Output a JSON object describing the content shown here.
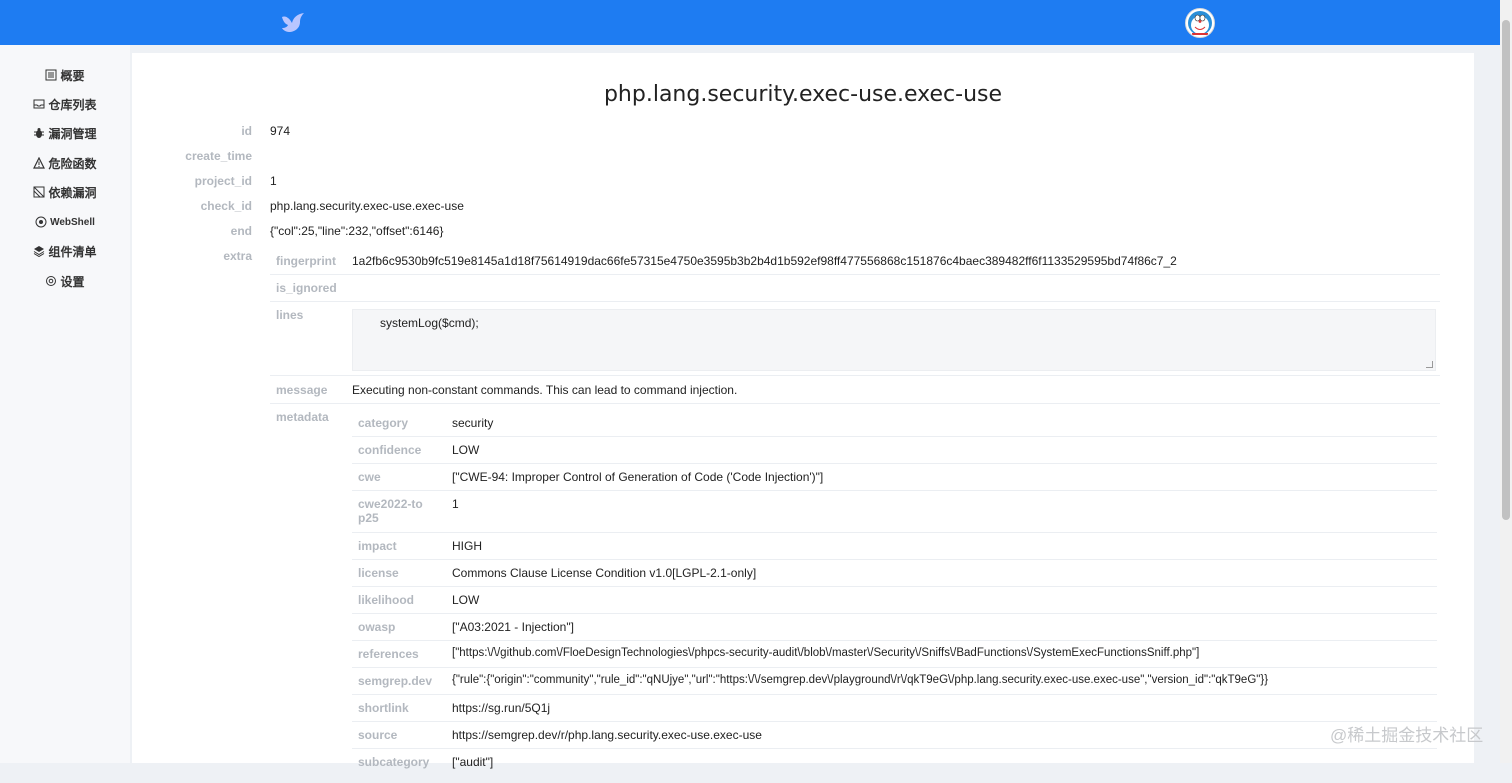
{
  "brand": {
    "logo_icon": "bird-logo-icon",
    "avatar_icon": "doraemon-avatar-icon",
    "accent": "#1e7cf2"
  },
  "sidebar": {
    "items": [
      {
        "label": "概要",
        "icon": "list-icon"
      },
      {
        "label": "仓库列表",
        "icon": "inbox-icon"
      },
      {
        "label": "漏洞管理",
        "icon": "bug-icon"
      },
      {
        "label": "危险函数",
        "icon": "warning-icon"
      },
      {
        "label": "依赖漏洞",
        "icon": "dependency-icon"
      },
      {
        "label": "WebShell",
        "icon": "eye-icon"
      },
      {
        "label": "组件清单",
        "icon": "layers-icon"
      },
      {
        "label": "设置",
        "icon": "gear-icon"
      }
    ]
  },
  "detail": {
    "title": "php.lang.security.exec-use.exec-use",
    "fields": [
      {
        "label": "id",
        "value": "974"
      },
      {
        "label": "create_time",
        "value": ""
      },
      {
        "label": "project_id",
        "value": "1"
      },
      {
        "label": "check_id",
        "value": "php.lang.security.exec-use.exec-use"
      },
      {
        "label": "end",
        "value": "{\"col\":25,\"line\":232,\"offset\":6146}"
      },
      {
        "label": "extra",
        "value": ""
      }
    ],
    "extra": {
      "fingerprint_label": "fingerprint",
      "fingerprint": "1a2fb6c9530b9fc519e8145a1d18f75614919dac66fe57315e4750e3595b3b2b4d1b592ef98ff477556868c151876c4baec389482ff6f1133529595bd74f86c7_2",
      "is_ignored_label": "is_ignored",
      "is_ignored": "",
      "lines_label": "lines",
      "lines": "systemLog($cmd);",
      "message_label": "message",
      "message": "Executing non-constant commands. This can lead to command injection.",
      "metadata_label": "metadata"
    },
    "metadata": [
      {
        "key": "category",
        "value": "security"
      },
      {
        "key": "confidence",
        "value": "LOW"
      },
      {
        "key": "cwe",
        "value": "[\"CWE-94: Improper Control of Generation of Code ('Code Injection')\"]"
      },
      {
        "key": "cwe2022-top25",
        "value": "1"
      },
      {
        "key": "impact",
        "value": "HIGH"
      },
      {
        "key": "license",
        "value": "Commons Clause License Condition v1.0[LGPL-2.1-only]"
      },
      {
        "key": "likelihood",
        "value": "LOW"
      },
      {
        "key": "owasp",
        "value": "[\"A03:2021 - Injection\"]"
      },
      {
        "key": "references",
        "value": "[\"https:\\/\\/github.com\\/FloeDesignTechnologies\\/phpcs-security-audit\\/blob\\/master\\/Security\\/Sniffs\\/BadFunctions\\/SystemExecFunctionsSniff.php\"]"
      },
      {
        "key": "semgrep.dev",
        "value": "{\"rule\":{\"origin\":\"community\",\"rule_id\":\"qNUjye\",\"url\":\"https:\\/\\/semgrep.dev\\/playground\\/r\\/qkT9eG\\/php.lang.security.exec-use.exec-use\",\"version_id\":\"qkT9eG\"}}"
      },
      {
        "key": "shortlink",
        "value": "https://sg.run/5Q1j"
      },
      {
        "key": "source",
        "value": "https://semgrep.dev/r/php.lang.security.exec-use.exec-use"
      },
      {
        "key": "subcategory",
        "value": "[\"audit\"]"
      }
    ]
  },
  "watermark": "@稀土掘金技术社区"
}
